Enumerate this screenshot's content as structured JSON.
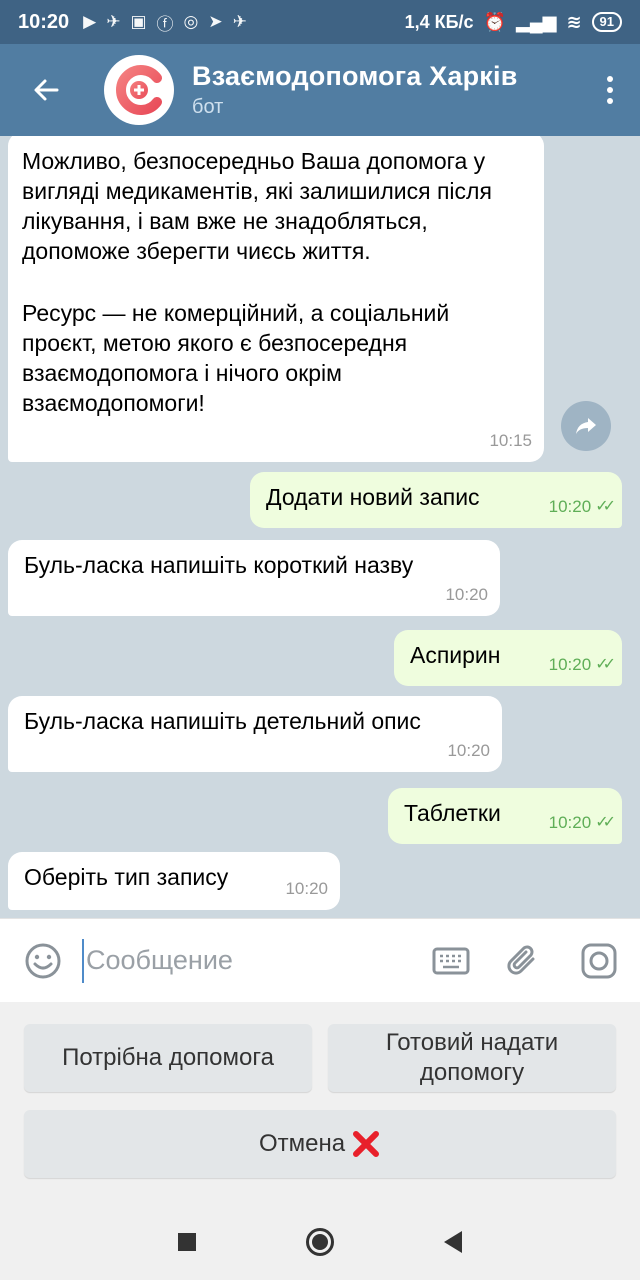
{
  "status_bar": {
    "time": "10:20",
    "speed": "1,4 КБ/с",
    "battery": "91"
  },
  "header": {
    "title": "Взаємодопомога Харків",
    "subtitle": "бот"
  },
  "messages": {
    "m1": {
      "p1": "Можливо, безпосередньо Ваша допомога у вигляді медикаментів, які залишилися після лікування, і вам вже не знадобляться, допоможе зберегти чиєсь життя.",
      "p2": "Ресурс — не комерційний, а соціальний проєкт, метою якого є безпосередня взаємодопомога і нічого окрім взаємодопомоги!",
      "time": "10:15"
    },
    "m2": {
      "text": "Додати новий запис",
      "time": "10:20"
    },
    "m3": {
      "text": "Буль-ласка напишіть короткий назву",
      "time": "10:20"
    },
    "m4": {
      "text": "Аспирин",
      "time": "10:20"
    },
    "m5": {
      "text": "Буль-ласка напишіть детельний опис",
      "time": "10:20"
    },
    "m6": {
      "text": "Таблетки",
      "time": "10:20"
    },
    "m7": {
      "text": "Оберіть тип запису",
      "time": "10:20"
    }
  },
  "composer": {
    "placeholder": "Сообщение"
  },
  "keyboard": {
    "btn1": "Потрібна допомога",
    "btn2_line1": "Готовий надати",
    "btn2_line2": "допомогу",
    "btn3": "Отмена"
  },
  "colors": {
    "header": "#517da2",
    "status_bar": "#3f6384",
    "outgoing": "#effdde",
    "incoming": "#ffffff",
    "chat_bg": "#cdd8df",
    "cancel_x": "#e8202a"
  }
}
